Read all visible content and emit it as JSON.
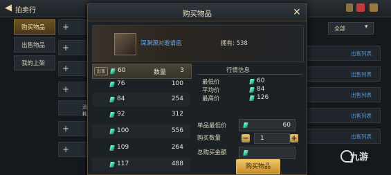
{
  "background": {
    "title": "拍卖行",
    "tabs": [
      "购买物品",
      "出售物品",
      "我的上架"
    ],
    "filter_label": "全部",
    "list_link": "出售列表",
    "bg_row_text": "消耗"
  },
  "modal": {
    "title": "购买物品",
    "item_name": "深渊源对邀请函",
    "owned_label": "拥有:",
    "owned_value": "538",
    "sold_badge": "出售",
    "qty_header": "数量",
    "listings": [
      {
        "price": "60",
        "qty": "3"
      },
      {
        "price": "76",
        "qty": "100"
      },
      {
        "price": "84",
        "qty": "254"
      },
      {
        "price": "92",
        "qty": "312"
      },
      {
        "price": "100",
        "qty": "556"
      },
      {
        "price": "109",
        "qty": "264"
      },
      {
        "price": "117",
        "qty": "488"
      }
    ],
    "market_info": {
      "title": "行情信息",
      "min_label": "最低价",
      "min_value": "60",
      "avg_label": "平均价",
      "avg_value": "84",
      "max_label": "最高价",
      "max_value": "126"
    },
    "form": {
      "unit_price_label": "单品最低价",
      "unit_price_value": "60",
      "qty_label": "购买数量",
      "qty_value": "1",
      "total_label": "总购买金额",
      "buy_button": "购买物品"
    }
  },
  "watermark": "九游",
  "colors": {
    "gem": "#2fc79b",
    "link": "#69a6e8",
    "accent": "#c58c2a"
  }
}
